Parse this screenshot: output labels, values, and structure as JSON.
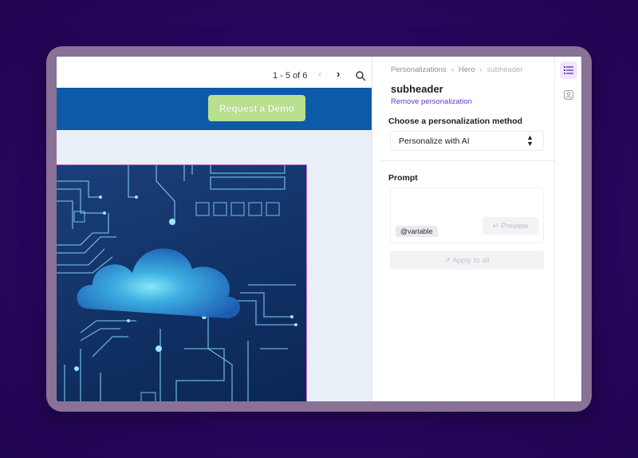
{
  "preview": {
    "pager_text": "1 - 5 of 6",
    "prev_icon": "‹",
    "next_icon": "›",
    "cta_label": "Request a Demo"
  },
  "panel": {
    "breadcrumb": [
      "Personalizations",
      "Hero",
      "subheader"
    ],
    "section_title": "subheader",
    "remove_link": "Remove personalization",
    "method_label": "Choose a personalization method",
    "method_value": "Personalize with AI",
    "prompt_label": "Prompt",
    "variable_chip": "@variable",
    "preview_button": "↵ Preview",
    "apply_button": "⇗ Apply to all"
  },
  "colors": {
    "background": "#2a0660",
    "hero_bar": "#0c5aa8",
    "cta": "#b8e08e",
    "accent": "#6a35c8"
  },
  "icons": [
    "search-icon",
    "chevron-left-icon",
    "chevron-right-icon",
    "chevrons-updown-icon",
    "list-icon",
    "user-icon"
  ]
}
